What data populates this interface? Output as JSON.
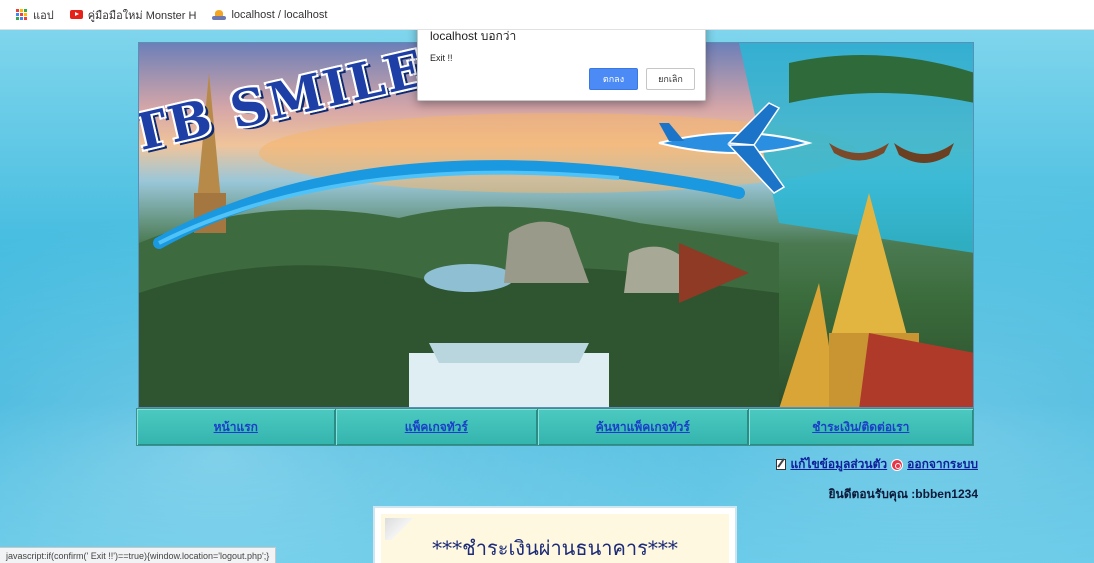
{
  "bookmarks": {
    "items": [
      {
        "label": "แอป",
        "icon": "apps-grid-icon"
      },
      {
        "label": "คู่มือมือใหม่ Monster H",
        "icon": "youtube-icon"
      },
      {
        "label": "localhost / localhost",
        "icon": "phpmyadmin-icon"
      }
    ]
  },
  "dialog": {
    "title": "localhost บอกว่า",
    "message": "Exit !!",
    "ok_label": "ตกลง",
    "cancel_label": "ยกเลิก"
  },
  "banner": {
    "title": "TB SMILE TOUR"
  },
  "nav": {
    "items": [
      {
        "label": "หน้าแรก"
      },
      {
        "label": "แพ็คเกจทัวร์"
      },
      {
        "label": "ค้นหาแพ็คเกจทัวร์"
      },
      {
        "label": "ชำระเงิน/ติดต่อเรา"
      }
    ]
  },
  "user": {
    "edit_profile": "แก้ไขข้อมูลส่วนตัว",
    "logout": "ออกจากระบบ",
    "welcome": "ยินดีตอนรับคุณ :bbben1234"
  },
  "payment": {
    "title": "***ชำระเงินผ่านธนาคาร***"
  },
  "status_bar": {
    "text": "javascript:if(confirm(' Exit !!')==true){window.location='logout.php';}"
  },
  "colors": {
    "nav_bg": "#3fbfb7",
    "nav_link": "#1a3fc8",
    "dialog_ok": "#4c8bf5",
    "title_blue": "#1d3fa6"
  }
}
